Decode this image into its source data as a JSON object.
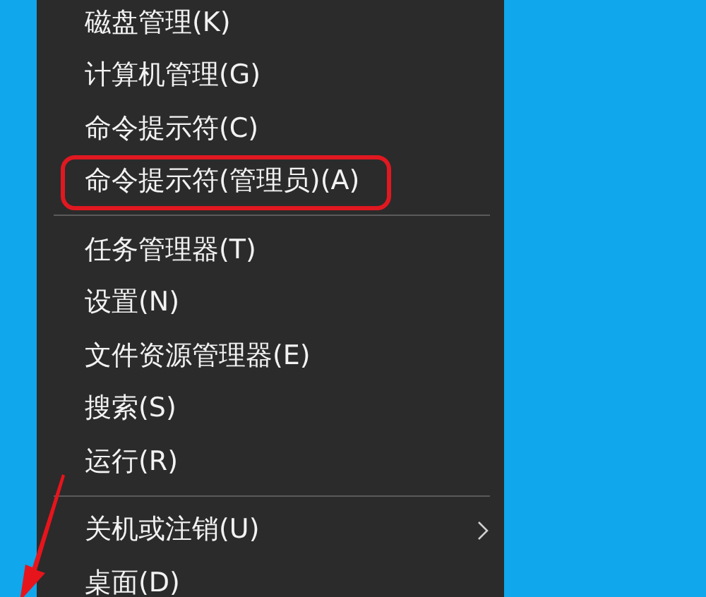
{
  "menu": {
    "groups": [
      {
        "items": [
          {
            "label": "磁盘管理(K)",
            "annotated": false,
            "submenu": false
          },
          {
            "label": "计算机管理(G)",
            "annotated": false,
            "submenu": false
          },
          {
            "label": "命令提示符(C)",
            "annotated": false,
            "submenu": false
          },
          {
            "label": "命令提示符(管理员)(A)",
            "annotated": true,
            "submenu": false
          }
        ]
      },
      {
        "items": [
          {
            "label": "任务管理器(T)",
            "annotated": false,
            "submenu": false
          },
          {
            "label": "设置(N)",
            "annotated": false,
            "submenu": false
          },
          {
            "label": "文件资源管理器(E)",
            "annotated": false,
            "submenu": false
          },
          {
            "label": "搜索(S)",
            "annotated": false,
            "submenu": false
          },
          {
            "label": "运行(R)",
            "annotated": false,
            "submenu": false
          }
        ]
      },
      {
        "items": [
          {
            "label": "关机或注销(U)",
            "annotated": false,
            "submenu": true
          },
          {
            "label": "桌面(D)",
            "annotated": false,
            "submenu": false
          }
        ]
      }
    ]
  },
  "annotation_arrow": true
}
